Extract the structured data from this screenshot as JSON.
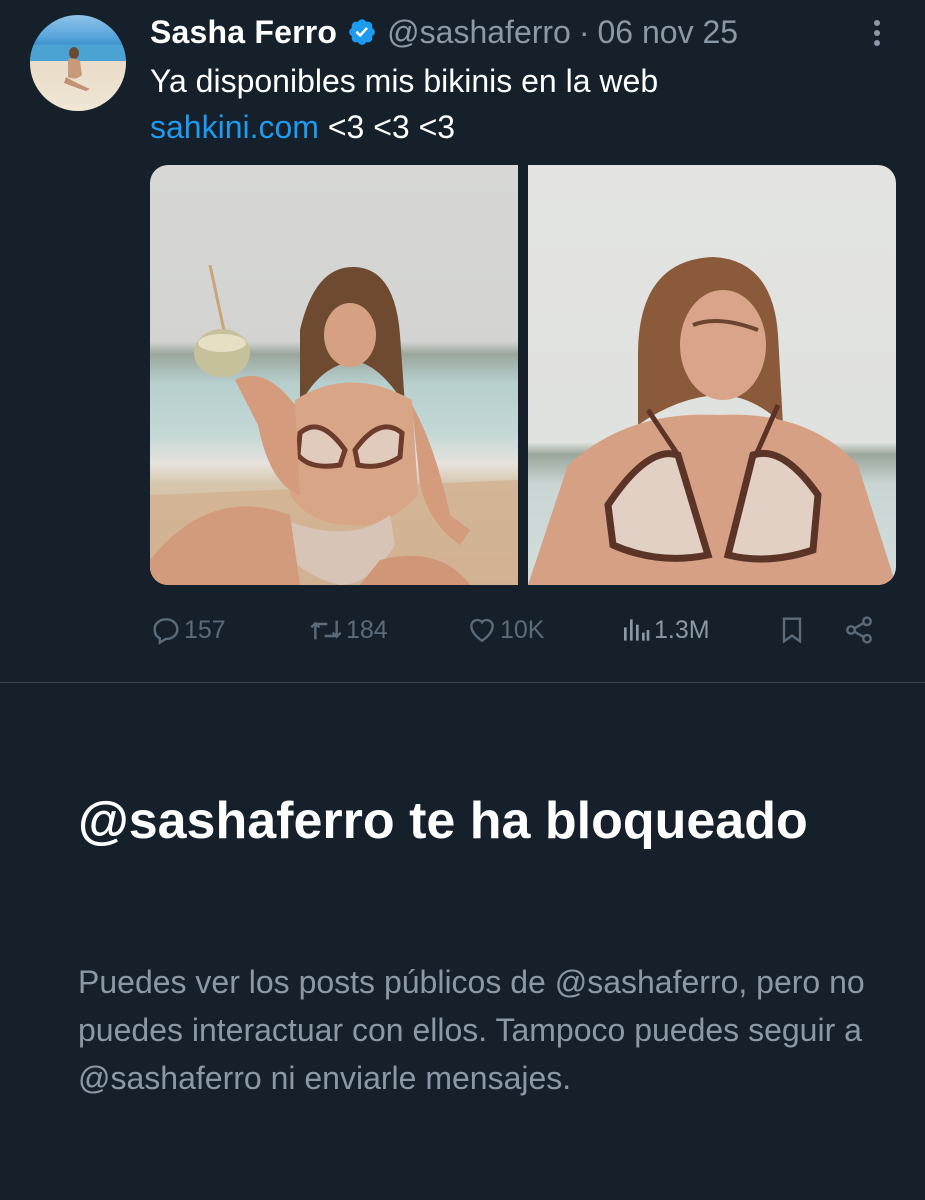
{
  "tweet": {
    "author_name": "Sasha Ferro",
    "handle": "@sashaferro",
    "separator": "·",
    "date": "06 nov 25",
    "text_line1": "Ya disponibles mis bikinis en la web",
    "link_text": "sahkini.com",
    "text_after_link": " <3 <3 <3",
    "icons": {
      "verified": "verified-badge-icon",
      "more": "more-vertical-icon"
    },
    "actions": {
      "replies": "157",
      "reposts": "184",
      "likes": "10K",
      "views": "1.3M"
    }
  },
  "blocked_notice": {
    "title": "@sashaferro te ha bloqueado",
    "description": "Puedes ver los posts públicos de @sashaferro, pero no puedes interactuar con ellos. Tampoco puedes seguir a @sashaferro ni enviarle mensajes."
  },
  "colors": {
    "background": "#15202b",
    "link": "#1d9bf0",
    "verified": "#1d9bf0",
    "secondary_text": "#8b98a5",
    "action_icon": "#5b6b79",
    "divider": "#38444d"
  }
}
